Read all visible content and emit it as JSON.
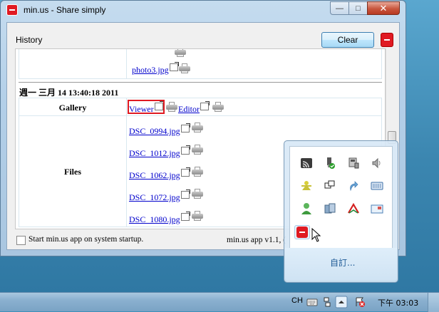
{
  "window": {
    "title": "min.us - Share simply",
    "buttons": {
      "minimize": "—",
      "maximize": "□",
      "close": "✕"
    }
  },
  "toolbar": {
    "history_label": "History",
    "clear_label": "Clear"
  },
  "history": {
    "previous_block": {
      "files": [
        "",
        "photo3.jpg"
      ]
    },
    "entry": {
      "timestamp": "週一 三月 14 13:40:18 2011",
      "gallery_label": "Gallery",
      "viewer_label": "Viewer",
      "editor_label": "Editor",
      "files_label": "Files",
      "files": [
        "DSC_0994.jpg",
        "DSC_1012.jpg",
        "DSC_1062.jpg",
        "DSC_1072.jpg",
        "DSC_1080.jpg"
      ]
    }
  },
  "footer": {
    "startup_label": "Start min.us app on system startup.",
    "startup_checked": false,
    "version_label": "min.us app v1.1, ("
  },
  "tray_flyout": {
    "icons": [
      "wireless-icon",
      "safely-remove-icon",
      "network-adapter-icon",
      "volume-icon",
      "messenger-icon",
      "display-icon",
      "update-arrow-icon",
      "keyboard-icon",
      "user-icon",
      "security-icon",
      "antivirus-icon",
      "mail-icon",
      "minus-app-icon"
    ],
    "customize_label": "自訂..."
  },
  "taskbar": {
    "language": "CH",
    "clock": "下午 03:03",
    "icons": [
      "keyboard-icon",
      "network-small-icon",
      "show-hidden-icons-icon",
      "action-center-icon"
    ]
  },
  "colors": {
    "accent_red": "#e01a22",
    "link_blue": "#0000cc",
    "highlight_box": "#e01a22"
  }
}
